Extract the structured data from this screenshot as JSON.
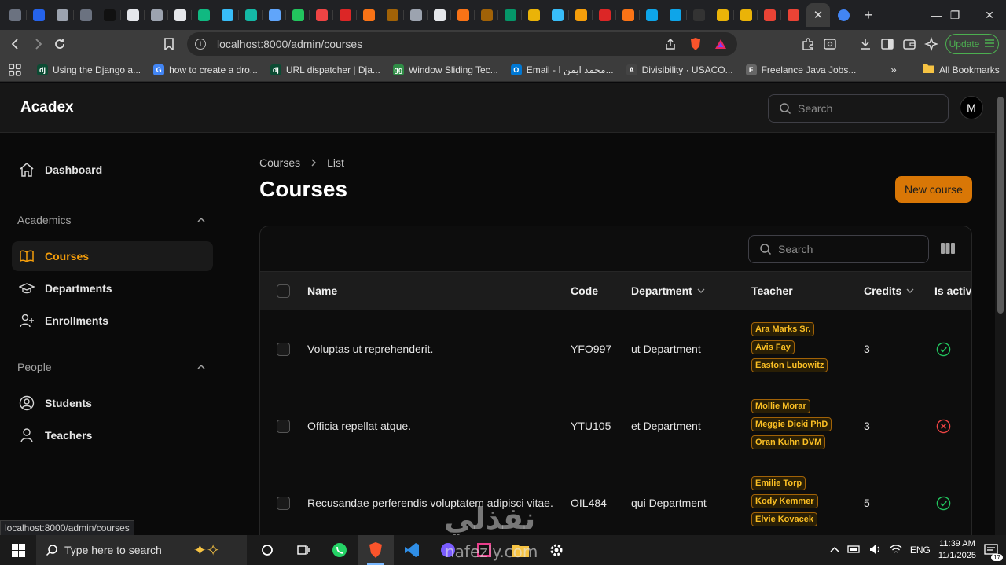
{
  "browser": {
    "tab_count_favicons": [
      "#6b7280",
      "#2563eb",
      "#9ca3af",
      "#6b7280",
      "#111111",
      "#e5e7eb",
      "#9ca3af",
      "#e5e7eb",
      "#10b981",
      "#38bdf8",
      "#14b8a6",
      "#60a5fa",
      "#22c55e",
      "#ef4444",
      "#dc2626",
      "#f97316",
      "#a16207",
      "#9ca3af",
      "#e5e7eb",
      "#f97316",
      "#a16207",
      "#059669",
      "#eab308",
      "#38bdf8",
      "#f59e0b",
      "#dc2626",
      "#f97316",
      "#0ea5e9",
      "#0ea5e9",
      "#333333",
      "#eab308",
      "#eab308",
      "#ea4335",
      "#ea4335"
    ],
    "url": "localhost:8000/admin/courses",
    "update_label": "Update",
    "bookmarks": [
      {
        "label": "Using the Django a...",
        "icon": "dj",
        "color": "#0c4b33"
      },
      {
        "label": "how to create a dro...",
        "icon": "G",
        "color": "#4285f4"
      },
      {
        "label": "URL dispatcher | Dja...",
        "icon": "dj",
        "color": "#0c4b33"
      },
      {
        "label": "Window Sliding Tec...",
        "icon": "gg",
        "color": "#2f8d46"
      },
      {
        "label": "Email - محمد ايمن ا...",
        "icon": "O",
        "color": "#0078d4"
      },
      {
        "label": "Divisibility · USACO...",
        "icon": "A",
        "color": "#444444"
      },
      {
        "label": "Freelance Java Jobs...",
        "icon": "F",
        "color": "#666666"
      }
    ],
    "all_bookmarks": "All Bookmarks",
    "status_url": "localhost:8000/admin/courses"
  },
  "app": {
    "brand": "Acadex",
    "search_placeholder": "Search",
    "avatar_initial": "M"
  },
  "sidebar": {
    "dashboard": "Dashboard",
    "group_academics": "Academics",
    "courses": "Courses",
    "departments": "Departments",
    "enrollments": "Enrollments",
    "group_people": "People",
    "students": "Students",
    "teachers": "Teachers"
  },
  "page": {
    "breadcrumb_root": "Courses",
    "breadcrumb_current": "List",
    "title": "Courses",
    "new_button": "New course",
    "table_search_placeholder": "Search",
    "accent": "#d97706"
  },
  "table": {
    "headers": {
      "name": "Name",
      "code": "Code",
      "department": "Department",
      "teacher": "Teacher",
      "credits": "Credits",
      "is_active": "Is active"
    },
    "rows": [
      {
        "name": "Voluptas ut reprehenderit.",
        "code": "YFO997",
        "department": "ut Department",
        "teachers": [
          "Ara Marks Sr.",
          "Avis Fay",
          "Easton Lubowitz"
        ],
        "credits": "3",
        "active": true
      },
      {
        "name": "Officia repellat atque.",
        "code": "YTU105",
        "department": "et Department",
        "teachers": [
          "Mollie Morar",
          "Meggie Dicki PhD",
          "Oran Kuhn DVM"
        ],
        "credits": "3",
        "active": false
      },
      {
        "name": "Recusandae perferendis voluptatem adipisci vitae.",
        "code": "OIL484",
        "department": "qui Department",
        "teachers": [
          "Emilie Torp",
          "Kody Kemmer",
          "Elvie Kovacek"
        ],
        "credits": "5",
        "active": true
      }
    ]
  },
  "taskbar": {
    "search_placeholder": "Type here to search",
    "language": "ENG",
    "time": "11:39 AM",
    "date": "11/1/2025",
    "notifications": "17"
  },
  "watermark": {
    "arabic": "نفذلي",
    "latin": "nafezly.com"
  }
}
